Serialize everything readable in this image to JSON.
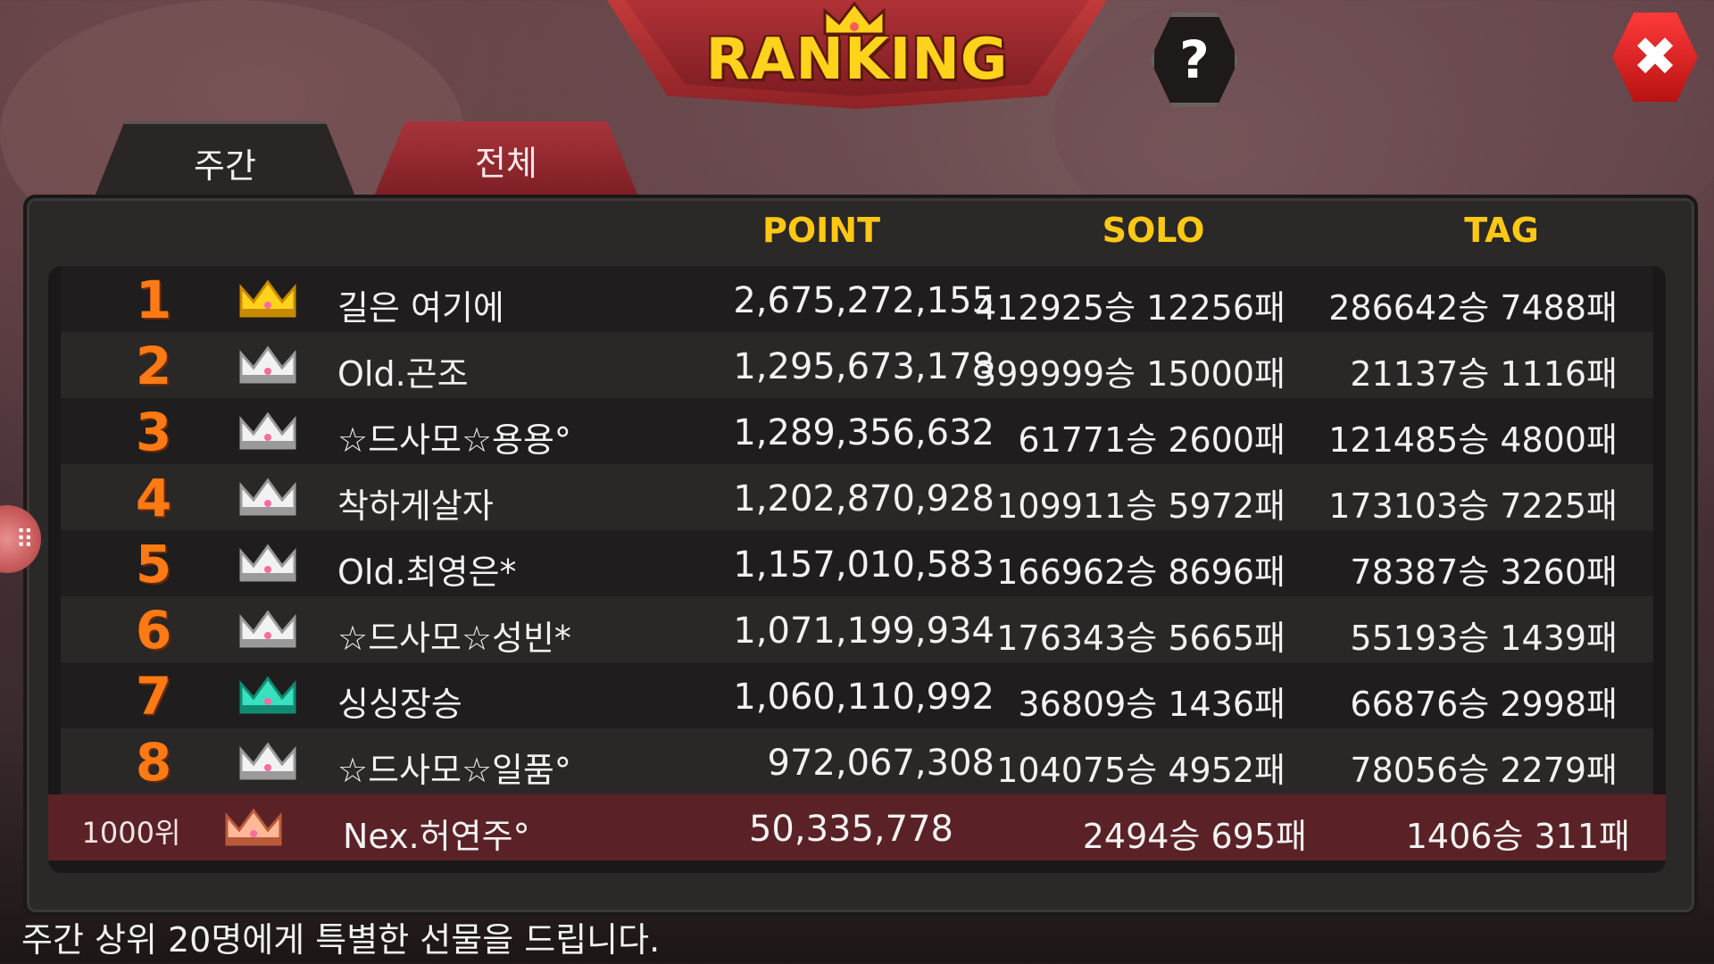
{
  "header": {
    "title": "RANKING",
    "help_label": "?",
    "close_label": "✖"
  },
  "tabs": [
    {
      "label": "주간",
      "active": true
    },
    {
      "label": "전체",
      "active": false
    }
  ],
  "columns": {
    "point": "POINT",
    "solo": "SOLO",
    "tag": "TAG"
  },
  "rows": [
    {
      "rank": "1",
      "crown": "gold-crown-icon",
      "name": "길은 여기에",
      "point": "2,675,272,155",
      "solo": "412925승 12256패",
      "tag": "286642승 7488패"
    },
    {
      "rank": "2",
      "crown": "silver-crown-icon",
      "name": "Old.곤조",
      "point": "1,295,673,178",
      "solo": "399999승 15000패",
      "tag": "21137승 1116패"
    },
    {
      "rank": "3",
      "crown": "silver-crown-icon",
      "name": "☆드사모☆용용°",
      "point": "1,289,356,632",
      "solo": "61771승 2600패",
      "tag": "121485승 4800패"
    },
    {
      "rank": "4",
      "crown": "silver-crown-icon",
      "name": "착하게살자",
      "point": "1,202,870,928",
      "solo": "109911승 5972패",
      "tag": "173103승 7225패"
    },
    {
      "rank": "5",
      "crown": "silver-crown-icon",
      "name": "Old.최영은*",
      "point": "1,157,010,583",
      "solo": "166962승 8696패",
      "tag": "78387승 3260패"
    },
    {
      "rank": "6",
      "crown": "silver-crown-icon",
      "name": "☆드사모☆성빈*",
      "point": "1,071,199,934",
      "solo": "176343승 5665패",
      "tag": "55193승 1439패"
    },
    {
      "rank": "7",
      "crown": "teal-crown-icon",
      "name": "싱싱장승",
      "point": "1,060,110,992",
      "solo": "36809승 1436패",
      "tag": "66876승 2998패"
    },
    {
      "rank": "8",
      "crown": "silver-crown-icon",
      "name": "☆드사모☆일품°",
      "point": "972,067,308",
      "solo": "104075승 4952패",
      "tag": "78056승 2279패"
    }
  ],
  "my_rank": {
    "rank": "1000위",
    "crown": "bronze-crown-icon",
    "name": "Nex.허연주°",
    "point": "50,335,778",
    "solo": "2494승 695패",
    "tag": "1406승 311패"
  },
  "footer": "주간 상위 20명에게 특별한 선물을 드립니다.",
  "colors": {
    "gold": "#ffc814",
    "rank_orange": "#ff7a14",
    "tab_red": "#a8343a",
    "mine_row": "#5a2226"
  }
}
